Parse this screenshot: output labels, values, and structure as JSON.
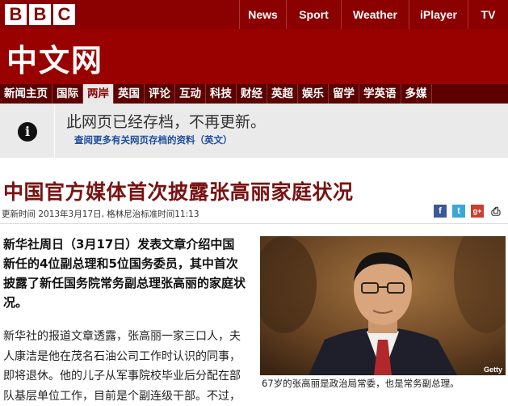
{
  "header": {
    "logo_letters": [
      "B",
      "B",
      "C"
    ],
    "nav": [
      "News",
      "Sport",
      "Weather",
      "iPlayer",
      "TV"
    ]
  },
  "masthead": {
    "title": "中文网"
  },
  "section_nav": {
    "items": [
      "新闻主页",
      "国际",
      "两岸",
      "英国",
      "评论",
      "互动",
      "科技",
      "财经",
      "英超",
      "娱乐",
      "留学",
      "学英语",
      "多媒"
    ],
    "active": "两岸"
  },
  "notice": {
    "icon": "info-icon",
    "message": "此网页已经存档，不再更新。",
    "link": "查阅更多有关网页存档的资料（英文）"
  },
  "article": {
    "headline": "中国官方媒体首次披露张高丽家庭状况",
    "meta": "更新时间 2013年3月17日, 格林尼治标准时间11:13",
    "share_icons": [
      "facebook-icon",
      "twitter-icon",
      "google-plus-icon",
      "print-icon"
    ],
    "lead": "新华社周日（3月17日）发表文章介绍中国新任的4位副总理和5位国务委员，其中首次披露了新任国务院常务副总理张高丽的家庭状况。",
    "paragraph": "新华社的报道文章透露，张高丽一家三口人，夫人康洁是他在茂名石油公司工作时认识的同事，即将退休。他的儿子从军事院校毕业后分配在部队基层单位工作，目前是个副连级干部。不过，",
    "photo_credit": "Getty",
    "caption": "67岁的张高丽是政治局常委，也是常务副总理。"
  },
  "colors": {
    "bbc_red": "#990000",
    "dark_red": "#5c0000",
    "headline": "#7a1212",
    "link": "#1f4e9c"
  }
}
